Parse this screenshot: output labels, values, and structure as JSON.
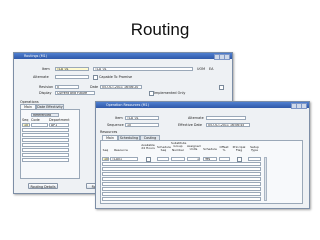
{
  "slide": {
    "title": "Routing"
  },
  "window_back": {
    "title": "Routings (M1)",
    "item_label": "Item",
    "item_value": "TLA_01",
    "item_desc": "TLA_01",
    "uom_label": "UOM",
    "uom_value": "EA",
    "alternate_label": "Alternate",
    "capable_label": "Capable To Promise",
    "revision_label": "Revision",
    "revision_value": "0",
    "date_label": "Date",
    "date_value": "05-OCT-2011 16:06:20",
    "display_label": "Display",
    "display_value": "Current and Future",
    "implemented_label": "Implemented Only",
    "operations_label": "Operations",
    "tabs": [
      "Main",
      "Date Effectivity"
    ],
    "referenced_label": "Referenced",
    "columns": [
      "Seq",
      "Code",
      "Department"
    ],
    "row1": {
      "seq": "10",
      "dept": "AP1"
    },
    "buttons": [
      "Routing Details",
      "Routing"
    ]
  },
  "window_front": {
    "title": "Operation Resources (M1)",
    "item_label": "Item",
    "item_value": "TLA_01",
    "alternate_label": "Alternate",
    "sequence_label": "Sequence",
    "sequence_value": "10",
    "eff_label": "Effective Date",
    "eff_value": "05-OCT-2011 16:06:45",
    "resources_label": "Resources",
    "tabs": [
      "Main",
      "Scheduling",
      "Costing"
    ],
    "columns": [
      "Seq",
      "Resource",
      "Available 24 Hours",
      "Schedule Seq",
      "Substitute Group Number",
      "Assigned Units",
      "Schedule",
      "Offset %",
      "Principal Flag",
      "Setup Type"
    ],
    "row1": {
      "seq": "10",
      "resource": "TLA01",
      "assigned": "1",
      "schedule": "Yes"
    }
  }
}
